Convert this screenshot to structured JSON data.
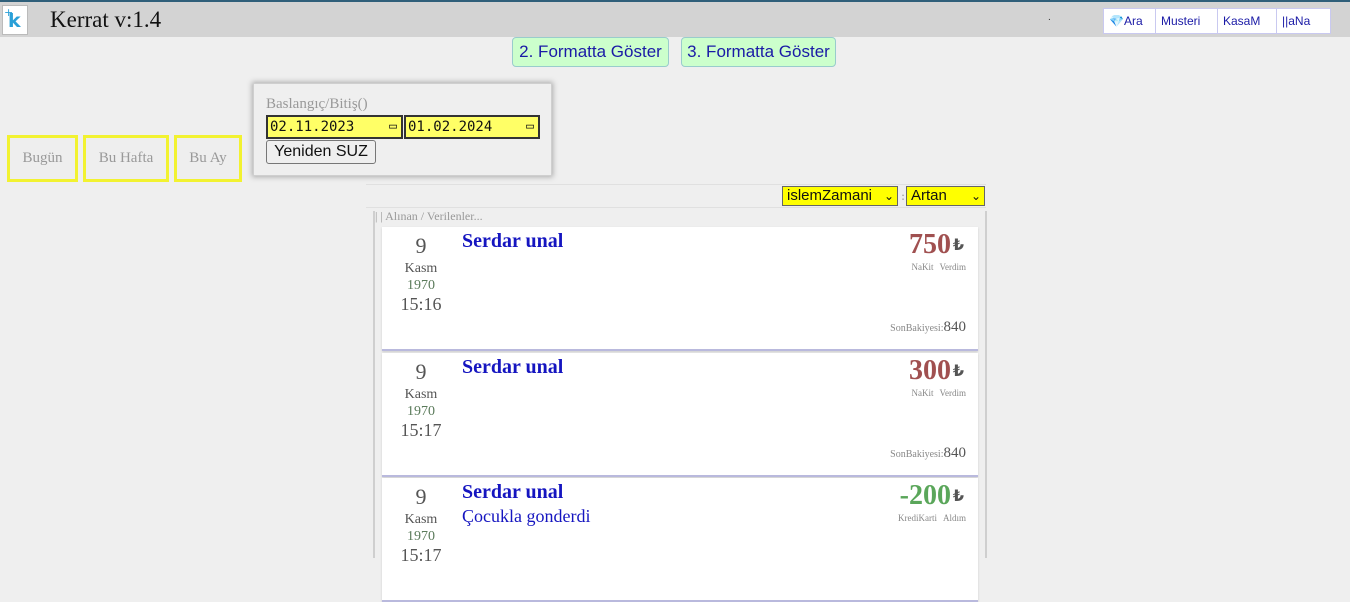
{
  "header": {
    "logo_letter": "k",
    "title": "Kerrat v:1.4",
    "dot": ".",
    "nav": [
      "💎Ara",
      "Musteri",
      "KasaM",
      "||aNa"
    ]
  },
  "format_buttons": [
    "2. Formatta Göster",
    "3. Formatta Göster"
  ],
  "quick_filters": [
    "Bugün",
    "Bu Hafta",
    "Bu Ay"
  ],
  "filter": {
    "label": "Baslangıç/Bitiş()",
    "start_date": "02.11.2023",
    "end_date": "01.02.2024",
    "calendar_icon": "calendar-icon",
    "refilter_label": "Yeniden SUZ"
  },
  "sort": {
    "field": "islemZamani",
    "separator": ":",
    "order": "Artan"
  },
  "list": {
    "header": "| | Alınan / Verilenler...",
    "currency": "₺",
    "balance_label": "SonBakiyesi:",
    "colors": {
      "positive": "#a05050",
      "negative": "#5aa65a",
      "name": "#1515c0"
    },
    "items": [
      {
        "day": "9",
        "month": "Kasm",
        "year": "1970",
        "time": "15:16",
        "name": "Serdar unal",
        "note": "",
        "amount": "750",
        "method": "NaKit",
        "direction": "Verdim",
        "balance": "840"
      },
      {
        "day": "9",
        "month": "Kasm",
        "year": "1970",
        "time": "15:17",
        "name": "Serdar unal",
        "note": "",
        "amount": "300",
        "method": "NaKit",
        "direction": "Verdim",
        "balance": "840"
      },
      {
        "day": "9",
        "month": "Kasm",
        "year": "1970",
        "time": "15:17",
        "name": "Serdar unal",
        "note": "Çocukla gonderdi",
        "amount": "-200",
        "method": "KrediKarti",
        "direction": "Aldım",
        "balance": ""
      }
    ]
  }
}
